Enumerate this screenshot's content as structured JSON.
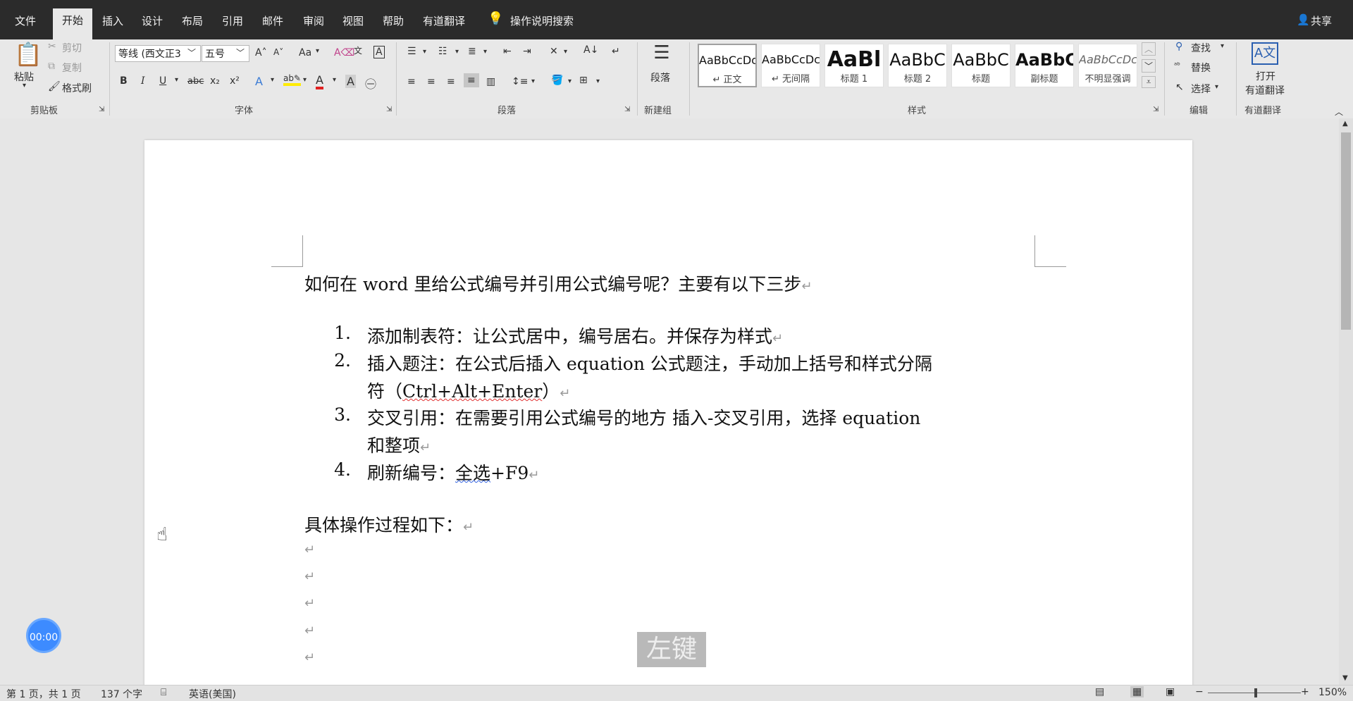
{
  "menu": {
    "tabs": [
      "文件",
      "开始",
      "插入",
      "设计",
      "布局",
      "引用",
      "邮件",
      "审阅",
      "视图",
      "帮助",
      "有道翻译"
    ],
    "tell_me": "操作说明搜索",
    "share": "共享"
  },
  "ribbon": {
    "clipboard": {
      "paste": "粘贴",
      "cut": "剪切",
      "copy": "复制",
      "format_painter": "格式刷",
      "label": "剪贴板"
    },
    "font": {
      "font_name": "等线 (西文正3",
      "font_size": "五号",
      "change_case": "Aa",
      "bold": "B",
      "italic": "I",
      "underline": "U",
      "strike": "abc",
      "sub": "x₂",
      "sup": "x²",
      "label": "字体"
    },
    "paragraph": {
      "label": "段落"
    },
    "new_group": {
      "button": "段落",
      "label": "新建组"
    },
    "styles": {
      "label": "样式",
      "items": [
        {
          "sample": "AaBbCcDc",
          "name": "正文"
        },
        {
          "sample": "AaBbCcDc",
          "name": "无间隔"
        },
        {
          "sample": "AaBl",
          "name": "标题 1"
        },
        {
          "sample": "AaBbC",
          "name": "标题 2"
        },
        {
          "sample": "AaBbC",
          "name": "标题"
        },
        {
          "sample": "AaBbC",
          "name": "副标题"
        },
        {
          "sample": "AaBbCcDc",
          "name": "不明显强调"
        }
      ]
    },
    "editing": {
      "find": "查找",
      "replace": "替换",
      "select": "选择",
      "label": "编辑"
    },
    "youdao": {
      "open": "打开",
      "open2": "有道翻译",
      "label": "有道翻译"
    }
  },
  "document": {
    "intro": "如何在 word 里给公式编号并引用公式编号呢？主要有以下三步",
    "list": [
      {
        "num": "1.",
        "line1": "添加制表符：让公式居中，编号居右。并保存为样式"
      },
      {
        "num": "2.",
        "line1": "插入题注：在公式后插入 equation 公式题注，手动加上括号和样式分隔",
        "line2_pre": "符（",
        "line2_squig": "Ctrl+Alt+Enter",
        "line2_post": "）"
      },
      {
        "num": "3.",
        "line1": "交叉引用：在需要引用公式编号的地方  插入-交叉引用，选择 equation",
        "line2": "和整项"
      },
      {
        "num": "4.",
        "line1_pre": "刷新编号：",
        "line1_squig": "全选",
        "line1_post": "+F9"
      }
    ],
    "process": "具体操作过程如下：",
    "para_mark": "↵"
  },
  "status": {
    "page": "第 1 页，共 1 页",
    "words": "137 个字",
    "lang": "英语(美国)",
    "zoom": "150%"
  },
  "overlay": {
    "timer": "00:00",
    "click": "左键"
  }
}
